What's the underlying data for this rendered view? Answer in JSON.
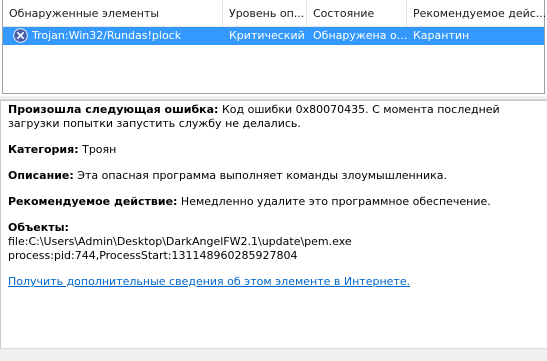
{
  "table": {
    "headers": [
      "Обнаруженные элементы",
      "Уровень оп...",
      "Состояние",
      "Рекомендуемое дейс..."
    ],
    "rows": [
      {
        "name": "Trojan:Win32/Rundas!plock",
        "level": "Критический",
        "status": "Обнаружена о...",
        "action": "Карантин"
      }
    ]
  },
  "details": {
    "error_label": "Произошла следующая ошибка:",
    "error_text": " Код ошибки 0x80070435. С момента последней загрузки попытки запустить службу не делались.",
    "category_label": "Категория:",
    "category_value": " Троян",
    "description_label": "Описание:",
    "description_value": " Эта опасная программа выполняет команды злоумышленника.",
    "recommended_label": "Рекомендуемое действие:",
    "recommended_value": " Немедленно удалите это программное обеспечение.",
    "objects_label": "Объекты:",
    "objects": [
      "file:C:\\Users\\Admin\\Desktop\\DarkAngelFW2.1\\update\\pem.exe",
      "process:pid:744,ProcessStart:131148960285927804"
    ],
    "more_info_link": "Получить дополнительные сведения об этом элементе в Интернете."
  },
  "colors": {
    "selection": "#3399ff",
    "link": "#0066cc",
    "threat_icon": "#4a5fa8"
  }
}
